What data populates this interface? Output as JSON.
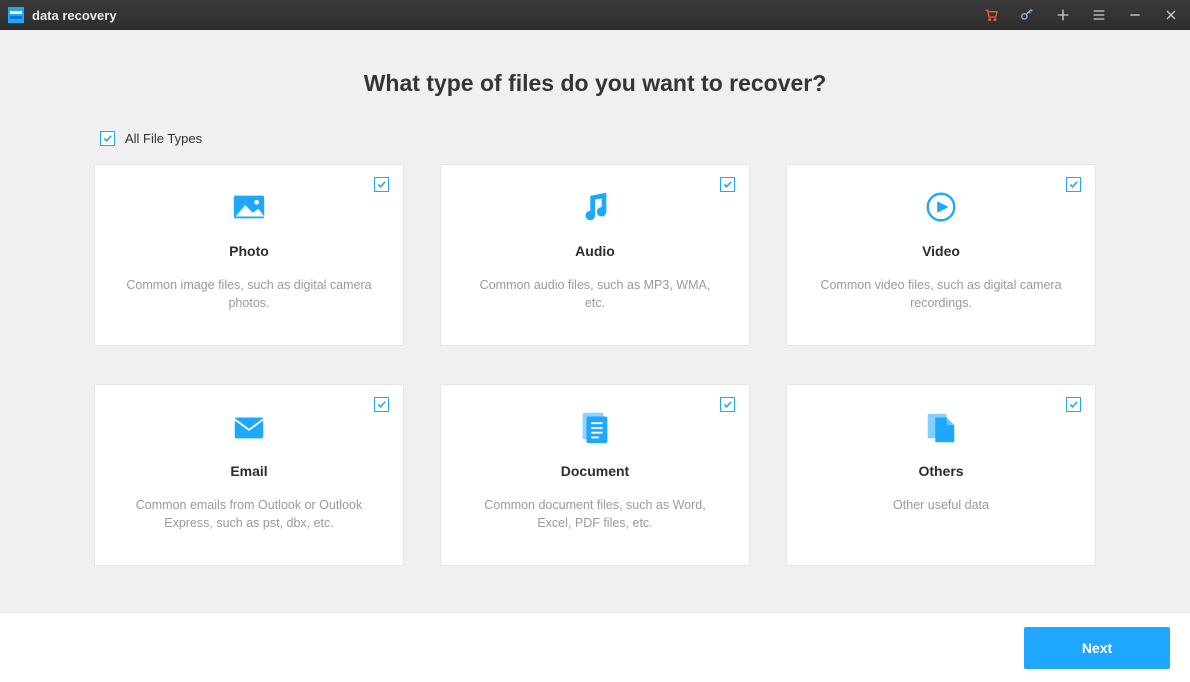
{
  "app": {
    "title": "data recovery"
  },
  "heading": "What type of files do you want to recover?",
  "allTypes": {
    "label": "All File Types",
    "checked": true
  },
  "cards": [
    {
      "id": "photo",
      "title": "Photo",
      "desc": "Common image files, such as digital camera photos.",
      "checked": true
    },
    {
      "id": "audio",
      "title": "Audio",
      "desc": "Common audio files, such as MP3, WMA, etc.",
      "checked": true
    },
    {
      "id": "video",
      "title": "Video",
      "desc": "Common video files, such as digital camera recordings.",
      "checked": true
    },
    {
      "id": "email",
      "title": "Email",
      "desc": "Common emails from Outlook or Outlook Express, such as pst, dbx, etc.",
      "checked": true
    },
    {
      "id": "document",
      "title": "Document",
      "desc": "Common document files, such as Word, Excel, PDF files, etc.",
      "checked": true
    },
    {
      "id": "others",
      "title": "Others",
      "desc": "Other useful data",
      "checked": true
    }
  ],
  "footer": {
    "next": "Next"
  },
  "colors": {
    "accent": "#1ea7fd",
    "cart": "#e85b3a"
  }
}
